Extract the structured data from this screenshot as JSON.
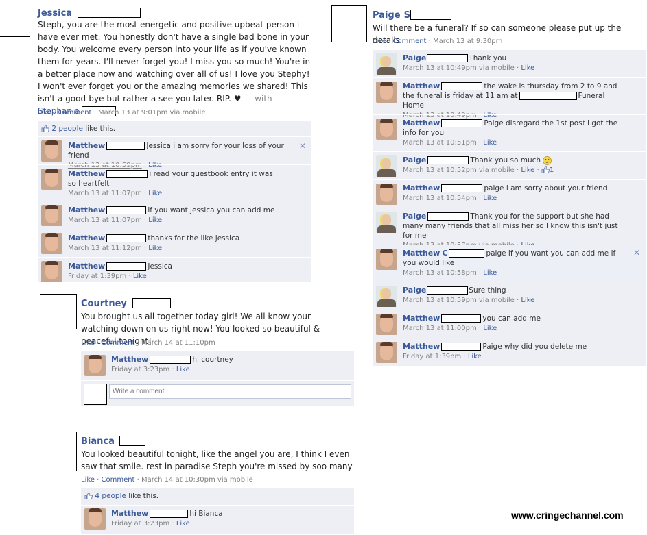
{
  "common": {
    "like": "Like",
    "comment": "Comment",
    "sep": " · "
  },
  "jessica_post": {
    "name": "Jessica",
    "text": "Steph, you are the most energetic and positive upbeat person i have ever met. You honestly don't have a single bad bone in your body. You welcome every person into your life as if you've known them for years. I'll never forget you! I miss you so much! You're in a better place now and watching over all of us! I love you Stephy! I won't ever forget you or the amazing memories we shared! This isn't a good-bye but rather a see you later. RIP. ♥",
    "with_prefix": "— with",
    "with_name": "Stephanie",
    "time": "March 13 at 9:01pm via mobile",
    "likes_count": "2 people",
    "likes_suffix": "like this.",
    "comments": [
      {
        "name": "Matthew",
        "text": "Jessica i am sorry for your loss of your friend",
        "time": "March 13 at 10:59pm"
      },
      {
        "name": "Matthew",
        "text": "i read your guestbook entry it was so heartfelt",
        "time": "March 13 at 11:07pm"
      },
      {
        "name": "Matthew",
        "text": "if you want jessica you can add me",
        "time": "March 13 at 11:07pm"
      },
      {
        "name": "Matthew",
        "text": "thanks for the like jessica",
        "time": "March 13 at 11:12pm"
      },
      {
        "name": "Matthew",
        "text": "Jessica",
        "time": "Friday at 1:39pm"
      }
    ]
  },
  "courtney_post": {
    "name": "Courtney",
    "text": "You brought us all together today girl! We all know your watching down on us right now! You looked so beautiful & peaceful tonight!",
    "time": "March 14 at 11:10pm",
    "comments": [
      {
        "name": "Matthew",
        "text": "hi courtney",
        "time": "Friday at 3:23pm"
      }
    ],
    "write_placeholder": "Write a comment..."
  },
  "bianca_post": {
    "name": "Bianca",
    "text": "You looked beautiful tonight, like the angel you are, I think I even saw that smile. rest in paradise Steph you're missed by soo many",
    "time": "March 14 at 10:30pm via mobile",
    "likes_count": "4 people",
    "likes_suffix": "like this.",
    "comments": [
      {
        "name": "Matthew",
        "text": "hi Bianca",
        "time": "Friday at 3:23pm"
      }
    ]
  },
  "paige_post": {
    "name": "Paige",
    "name_suffix": "S",
    "text": "Will there be a funeral? If so can someone please put up the details",
    "time": "March 13 at 9:30pm",
    "comments": [
      {
        "name": "Paige",
        "text": "Thank you",
        "time": "March 13 at 10:49pm via mobile"
      },
      {
        "name": "Matthew",
        "text": "the wake is thursday from 2 to 9 and the funeral is friday at 11 am at",
        "text2": "Funeral Home",
        "time": "March 13 at 10:49pm"
      },
      {
        "name": "Matthew",
        "text": "Paige disregard the 1st post i got the info for you",
        "time": "March 13 at 10:51pm"
      },
      {
        "name": "Paige",
        "text": "Thank you so much",
        "time": "March 13 at 10:52pm via mobile",
        "like_count": "1"
      },
      {
        "name": "Matthew",
        "text": "paige i am sorry about your friend",
        "time": "March 13 at 10:54pm"
      },
      {
        "name": "Paige",
        "text": "Thank you for the support but she had many many friends that all miss her so I know this isn't just for me",
        "time": "March 13 at 10:57pm via mobile"
      },
      {
        "name": "Matthew",
        "name_suffix": "C",
        "text": "paige if you want you can add me if you would like",
        "time": "March 13 at 10:58pm"
      },
      {
        "name": "Paige",
        "text": "Sure thing",
        "time": "March 13 at 10:59pm via mobile"
      },
      {
        "name": "Matthew",
        "text": "you can add me",
        "time": "March 13 at 11:00pm"
      },
      {
        "name": "Matthew",
        "text": "Paige why did you delete me",
        "time": "Friday at 1:39pm"
      }
    ]
  },
  "watermark": "www.cringechannel.com"
}
